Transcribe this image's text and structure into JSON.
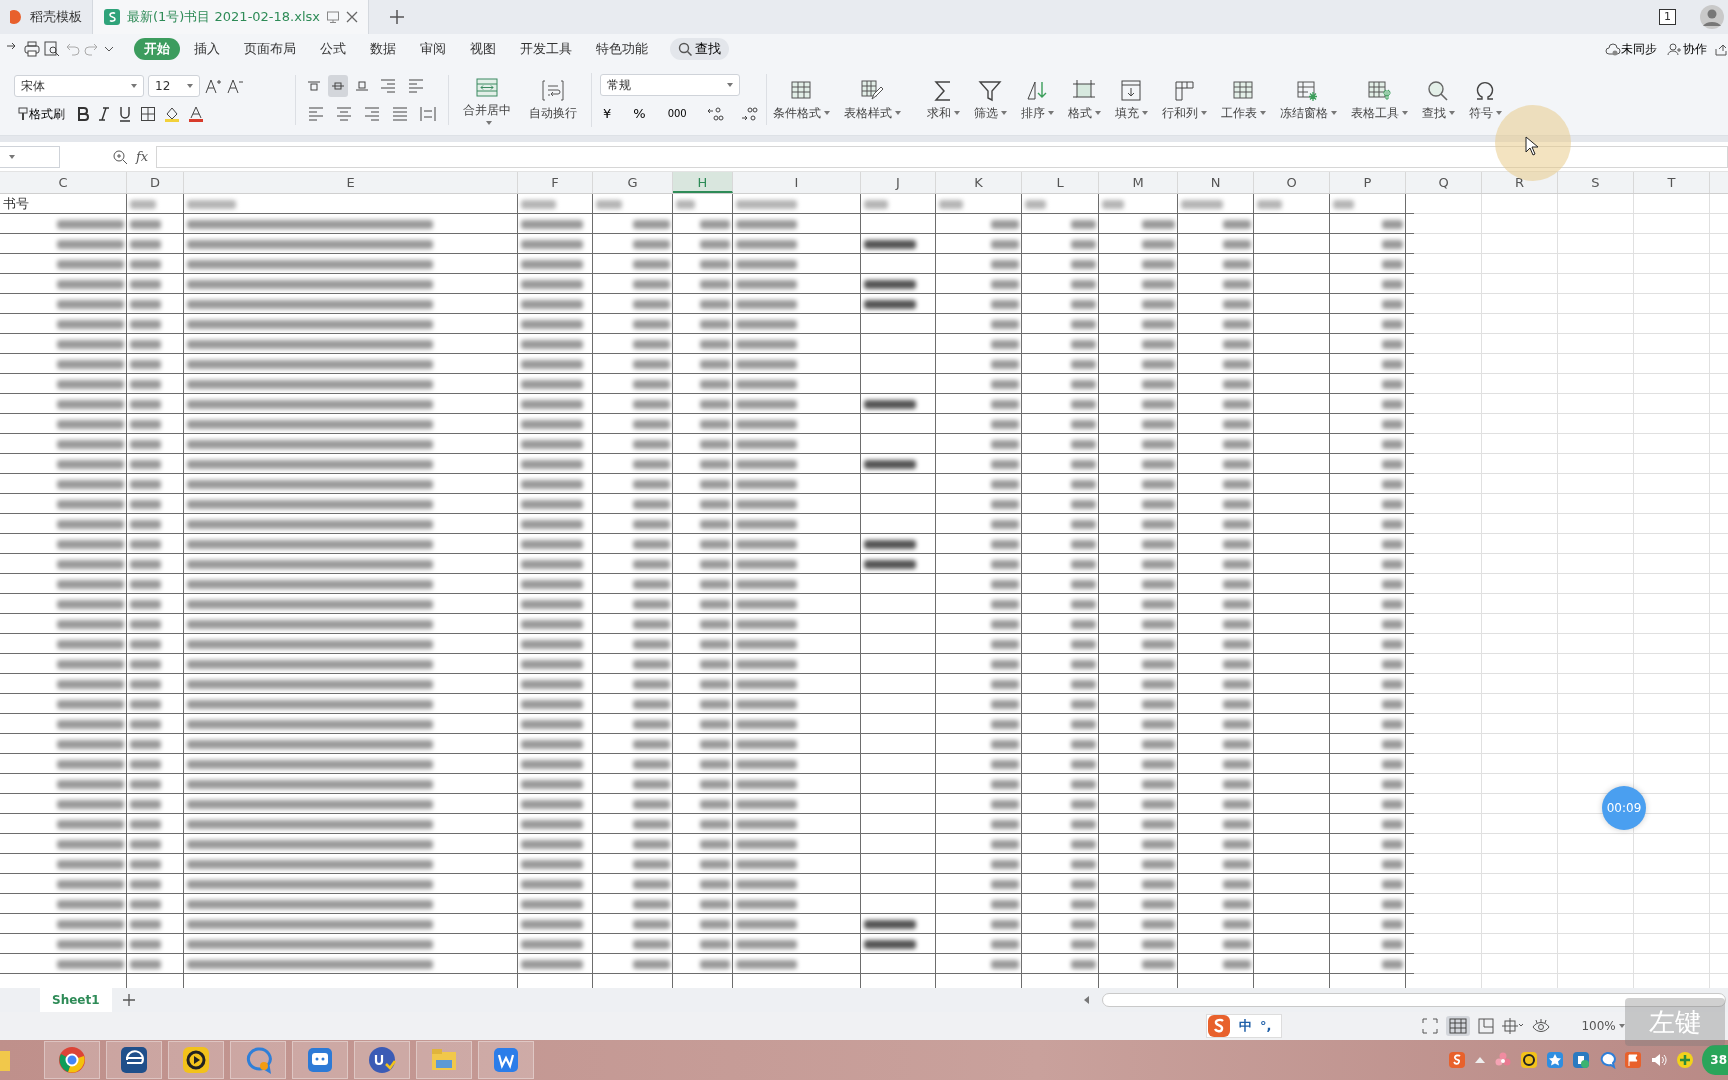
{
  "tabs": [
    {
      "label": "稻壳模板",
      "selected": false
    },
    {
      "label": "最新(1号)书目 2021-02-18.xlsx",
      "selected": true
    }
  ],
  "window_badge": "1",
  "menu": [
    {
      "label": "开始",
      "selected": true
    },
    {
      "label": "插入",
      "selected": false
    },
    {
      "label": "页面布局",
      "selected": false
    },
    {
      "label": "公式",
      "selected": false
    },
    {
      "label": "数据",
      "selected": false
    },
    {
      "label": "审阅",
      "selected": false
    },
    {
      "label": "视图",
      "selected": false
    },
    {
      "label": "开发工具",
      "selected": false
    },
    {
      "label": "特色功能",
      "selected": false
    }
  ],
  "menu_search": "查找",
  "sync_status": "未同步",
  "collaborate": "协作",
  "font": {
    "family": "宋体",
    "size": "12",
    "format_painter": "格式刷"
  },
  "vertical_align": [
    {
      "selected": false
    },
    {
      "selected": true
    },
    {
      "selected": false
    }
  ],
  "merge_buttons": [
    {
      "label": "合并居中"
    },
    {
      "label": "自动换行"
    }
  ],
  "number_format": {
    "value": "常规",
    "currency": "¥",
    "percent": "%",
    "thousands": "000"
  },
  "ribbon_buttons": [
    {
      "label": "条件格式"
    },
    {
      "label": "表格样式"
    },
    {
      "label": "求和"
    },
    {
      "label": "筛选"
    },
    {
      "label": "排序"
    },
    {
      "label": "格式"
    },
    {
      "label": "填充"
    },
    {
      "label": "行和列"
    },
    {
      "label": "工作表"
    },
    {
      "label": "冻结窗格"
    },
    {
      "label": "表格工具"
    },
    {
      "label": "查找"
    },
    {
      "label": "符号"
    }
  ],
  "formula_bar": {
    "fx": "fx"
  },
  "columns": [
    {
      "label": "C",
      "selected": false
    },
    {
      "label": "D",
      "selected": false
    },
    {
      "label": "E",
      "selected": false
    },
    {
      "label": "F",
      "selected": false
    },
    {
      "label": "G",
      "selected": false
    },
    {
      "label": "H",
      "selected": true
    },
    {
      "label": "I",
      "selected": false
    },
    {
      "label": "J",
      "selected": false
    },
    {
      "label": "K",
      "selected": false
    },
    {
      "label": "L",
      "selected": false
    },
    {
      "label": "M",
      "selected": false
    },
    {
      "label": "N",
      "selected": false
    },
    {
      "label": "O",
      "selected": false
    },
    {
      "label": "P",
      "selected": false
    },
    {
      "label": "Q",
      "selected": false
    },
    {
      "label": "R",
      "selected": false
    },
    {
      "label": "S",
      "selected": false
    },
    {
      "label": "T",
      "selected": false
    }
  ],
  "header_row": {
    "first_cell": "书号"
  },
  "rows": [
    {
      "kind": "blurred",
      "column_j_text": false
    },
    {
      "kind": "blurred",
      "column_j_text": true
    },
    {
      "kind": "blurred",
      "column_j_text": false
    },
    {
      "kind": "blurred",
      "column_j_text": true
    },
    {
      "kind": "blurred",
      "column_j_text": true
    },
    {
      "kind": "blurred",
      "column_j_text": false
    },
    {
      "kind": "blurred",
      "column_j_text": false
    },
    {
      "kind": "blurred",
      "column_j_text": false
    },
    {
      "kind": "blurred",
      "column_j_text": false
    },
    {
      "kind": "blurred",
      "column_j_text": true
    },
    {
      "kind": "blurred",
      "column_j_text": false
    },
    {
      "kind": "blurred",
      "column_j_text": false
    },
    {
      "kind": "blurred",
      "column_j_text": true
    },
    {
      "kind": "blurred",
      "column_j_text": false
    },
    {
      "kind": "blurred",
      "column_j_text": false
    },
    {
      "kind": "blurred",
      "column_j_text": false
    },
    {
      "kind": "blurred",
      "column_j_text": true
    },
    {
      "kind": "blurred",
      "column_j_text": true
    },
    {
      "kind": "blurred",
      "column_j_text": false
    },
    {
      "kind": "blurred",
      "column_j_text": false
    },
    {
      "kind": "blurred",
      "column_j_text": false
    },
    {
      "kind": "blurred",
      "column_j_text": false
    },
    {
      "kind": "blurred",
      "column_j_text": false
    },
    {
      "kind": "blurred",
      "column_j_text": false
    },
    {
      "kind": "blurred",
      "column_j_text": false
    },
    {
      "kind": "blurred",
      "column_j_text": false
    },
    {
      "kind": "blurred",
      "column_j_text": false
    },
    {
      "kind": "blurred",
      "column_j_text": false
    },
    {
      "kind": "blurred",
      "column_j_text": false
    },
    {
      "kind": "blurred",
      "column_j_text": false
    },
    {
      "kind": "blurred",
      "column_j_text": false
    },
    {
      "kind": "blurred",
      "column_j_text": false
    },
    {
      "kind": "blurred",
      "column_j_text": false
    },
    {
      "kind": "blurred",
      "column_j_text": false
    },
    {
      "kind": "blurred",
      "column_j_text": false
    },
    {
      "kind": "blurred",
      "column_j_text": true
    },
    {
      "kind": "blurred",
      "column_j_text": true
    },
    {
      "kind": "blurred",
      "column_j_text": false
    }
  ],
  "sheets": [
    {
      "label": "Sheet1",
      "selected": true
    }
  ],
  "ime": {
    "mode": "中",
    "punctuation": "°,"
  },
  "zoom": "100%",
  "recording": {
    "timer": "00:09",
    "key": "左键"
  },
  "tray_clock": "38"
}
